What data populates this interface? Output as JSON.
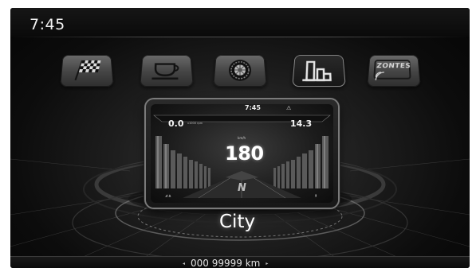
{
  "status_bar": {
    "time": "7:45"
  },
  "mode_icons": [
    {
      "name": "race-flag-icon",
      "selected": false
    },
    {
      "name": "coffee-cup-icon",
      "selected": false
    },
    {
      "name": "tire-wheel-icon",
      "selected": false
    },
    {
      "name": "city-buildings-icon",
      "selected": true
    },
    {
      "name": "zontes-brand-icon",
      "selected": false,
      "label": "ZONTES"
    }
  ],
  "dashboard_preview": {
    "time": "7:45",
    "left_value": "0.0",
    "left_unit": "x1000 rpm",
    "right_value": "14.3",
    "speed_unit": "km/h",
    "speed": "180",
    "gear": "N",
    "warning_icon": "warning-triangle-icon"
  },
  "mode_name": "City",
  "odometer": {
    "left_arrow": "◂",
    "value": "000 99999 km",
    "right_arrow": "▸"
  },
  "colors": {
    "background": "#0c0c0c",
    "text": "#ffffff",
    "accent": "#8a8a8a"
  }
}
